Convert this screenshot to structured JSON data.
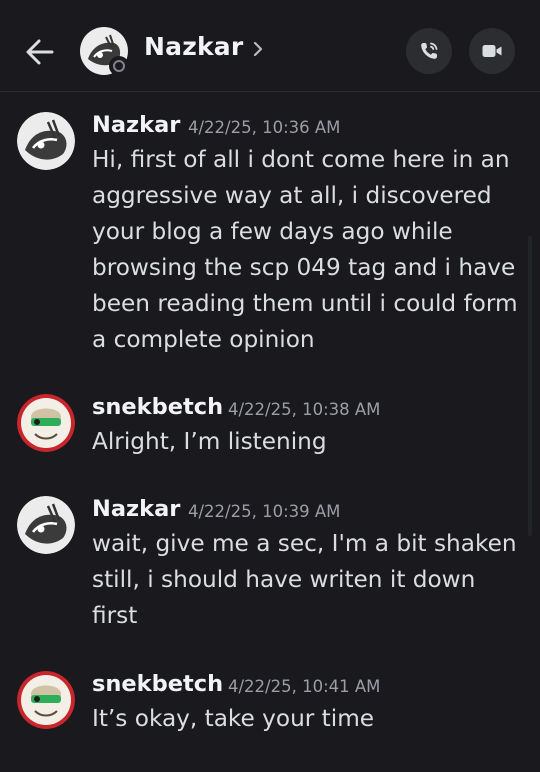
{
  "header": {
    "title": "Nazkar",
    "back_icon": "arrow-left-icon",
    "chevron_icon": "chevron-right-icon",
    "call_icon": "phone-call-icon",
    "video_icon": "video-camera-icon",
    "status": "offline"
  },
  "messages": [
    {
      "author": "Nazkar",
      "timestamp": "4/22/25, 10:36 AM",
      "text": "Hi, first of all i dont come here in an\naggressive way at all, i discovered\nyour blog a few days ago while\nbrowsing the scp 049 tag and i have\nbeen reading them until i could form\na complete opinion"
    },
    {
      "author": "snekbetch",
      "timestamp": "4/22/25, 10:38 AM",
      "text": "Alright, I’m listening"
    },
    {
      "author": "Nazkar",
      "timestamp": "4/22/25, 10:39 AM",
      "text": "wait, give me a sec, I'm a bit shaken\nstill, i should have writen it down\nfirst"
    },
    {
      "author": "snekbetch",
      "timestamp": "4/22/25, 10:41 AM",
      "text": "It’s okay, take your time"
    }
  ],
  "colors": {
    "background": "#1a1a1e",
    "author": "#f2f3f5",
    "text": "#dbdee1",
    "timestamp": "#9b9ea6",
    "button_bg": "#2b2d31"
  }
}
